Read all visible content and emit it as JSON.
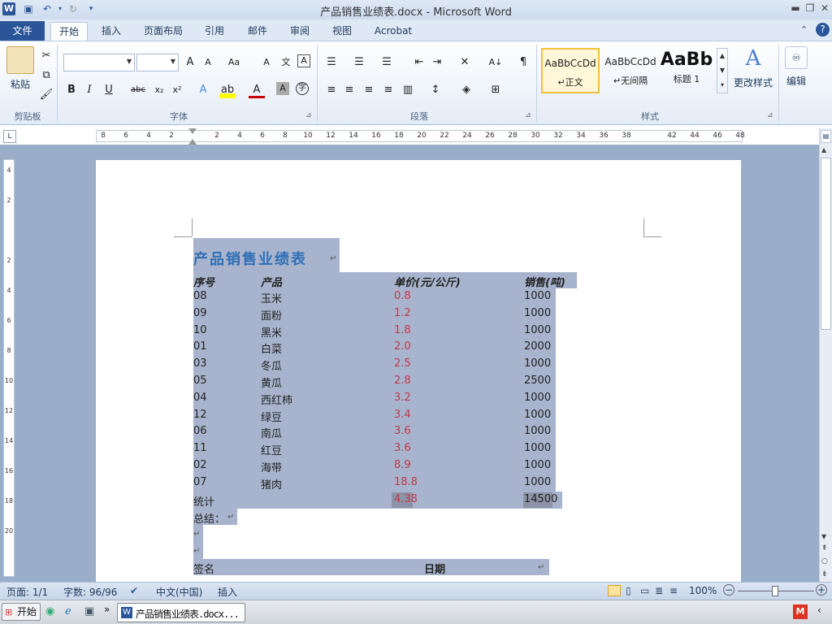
{
  "window": {
    "title": "产品销售业绩表.docx - Microsoft Word",
    "app_icon": "W"
  },
  "tabs": [
    "文件",
    "开始",
    "插入",
    "页面布局",
    "引用",
    "邮件",
    "审阅",
    "视图",
    "Acrobat"
  ],
  "ribbon": {
    "clipboard": {
      "label": "剪贴板",
      "paste": "粘贴"
    },
    "font": {
      "label": "字体"
    },
    "paragraph": {
      "label": "段落"
    },
    "styles": {
      "label": "样式",
      "items": [
        {
          "preview": "AaBbCcDd",
          "name": "↵正文"
        },
        {
          "preview": "AaBbCcDd",
          "name": "↵无间隔"
        },
        {
          "preview": "AaBb",
          "name": "标题 1"
        }
      ],
      "change": "更改样式"
    },
    "editing": {
      "label": "编辑"
    }
  },
  "ruler_h": [
    "8",
    "6",
    "4",
    "2",
    "",
    "2",
    "4",
    "6",
    "8",
    "10",
    "12",
    "14",
    "16",
    "18",
    "20",
    "22",
    "24",
    "26",
    "28",
    "30",
    "32",
    "34",
    "36",
    "38",
    "",
    "42",
    "44",
    "46",
    "48"
  ],
  "ruler_v": [
    "4",
    "2",
    "",
    "2",
    "4",
    "6",
    "8",
    "10",
    "12",
    "14",
    "16",
    "18",
    "20"
  ],
  "document": {
    "title": "产品销售业绩表",
    "headers": [
      "序号",
      "产品",
      "单价(元/公斤)",
      "销售(吨)"
    ],
    "rows": [
      [
        "08",
        "玉米",
        "0.8",
        "1000"
      ],
      [
        "09",
        "面粉",
        "1.2",
        "1000"
      ],
      [
        "10",
        "黑米",
        "1.8",
        "1000"
      ],
      [
        "01",
        "白菜",
        "2.0",
        "2000"
      ],
      [
        "03",
        "冬瓜",
        "2.5",
        "1000"
      ],
      [
        "05",
        "黄瓜",
        "2.8",
        "2500"
      ],
      [
        "04",
        "西红柿",
        "3.2",
        "1000"
      ],
      [
        "12",
        "绿豆",
        "3.4",
        "1000"
      ],
      [
        "06",
        "南瓜",
        "3.6",
        "1000"
      ],
      [
        "11",
        "红豆",
        "3.6",
        "1000"
      ],
      [
        "02",
        "海带",
        "8.9",
        "1000"
      ],
      [
        "07",
        "猪肉",
        "18.8",
        "1000"
      ]
    ],
    "total_label": "统计",
    "total_price": "4.38",
    "total_sales": "14500",
    "summary": "总结：",
    "sign": "签名",
    "date": "日期"
  },
  "status": {
    "page": "页面: 1/1",
    "words": "字数: 96/96",
    "lang": "中文(中国)",
    "mode": "插入",
    "zoom": "100%"
  },
  "taskbar": {
    "start": "开始",
    "task": "产品销售业绩表.docx..."
  },
  "colors": {
    "accent": "#2a5599",
    "highlight": "#a8b4cd",
    "red_values": "#c0394b",
    "title": "#2f6fb5"
  }
}
